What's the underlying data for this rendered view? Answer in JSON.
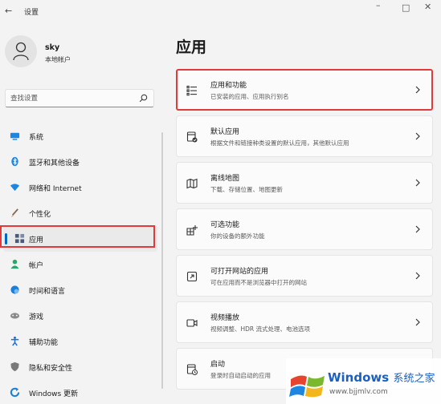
{
  "window": {
    "back_glyph": "←",
    "title": "设置",
    "controls": {
      "minimize": "–",
      "maximize": "□",
      "close": "✕"
    }
  },
  "user": {
    "name": "sky",
    "type": "本地帐户",
    "avatar_icon": "person-icon"
  },
  "search": {
    "placeholder": "查找设置",
    "icon": "search-icon"
  },
  "nav": {
    "items": [
      {
        "label": "系统",
        "icon": "monitor-icon",
        "color": "#0078d4"
      },
      {
        "label": "蓝牙和其他设备",
        "icon": "bluetooth-icon",
        "color": "#0078d4"
      },
      {
        "label": "网络和 Internet",
        "icon": "wifi-icon",
        "color": "#0078d4"
      },
      {
        "label": "个性化",
        "icon": "brush-icon",
        "color": "#d47a2a"
      },
      {
        "label": "应用",
        "icon": "apps-icon",
        "color": "#4a5a7a",
        "selected": true
      },
      {
        "label": "帐户",
        "icon": "account-icon",
        "color": "#2ea36b"
      },
      {
        "label": "时间和语言",
        "icon": "globe-clock-icon",
        "color": "#1c7fd6"
      },
      {
        "label": "游戏",
        "icon": "gamepad-icon",
        "color": "#7a7a7a"
      },
      {
        "label": "辅助功能",
        "icon": "accessibility-icon",
        "color": "#1c6fd6"
      },
      {
        "label": "隐私和安全性",
        "icon": "shield-icon",
        "color": "#6a6a6a"
      },
      {
        "label": "Windows 更新",
        "icon": "update-icon",
        "color": "#1c7fd6"
      }
    ]
  },
  "main": {
    "title": "应用",
    "cards": [
      {
        "title": "应用和功能",
        "subtitle": "已安装的应用、应用执行别名",
        "icon": "list-icon"
      },
      {
        "title": "默认应用",
        "subtitle": "根据文件和链接种类设置的默认应用，其他默认应用",
        "icon": "default-app-icon"
      },
      {
        "title": "离线地图",
        "subtitle": "下载、存储位置、地图更新",
        "icon": "map-icon"
      },
      {
        "title": "可选功能",
        "subtitle": "你的设备的额外功能",
        "icon": "optional-features-icon"
      },
      {
        "title": "可打开网站的应用",
        "subtitle": "可在应用而不是浏览器中打开的网站",
        "icon": "open-web-icon"
      },
      {
        "title": "视频播放",
        "subtitle": "视频调整、HDR 流式处理、电池选项",
        "icon": "video-icon"
      },
      {
        "title": "启动",
        "subtitle": "登录时自动启动的应用",
        "icon": "startup-icon"
      }
    ]
  },
  "watermark": {
    "brand": "Windows",
    "brand_suffix": "系统之家",
    "url": "www.bjjmlv.com"
  }
}
